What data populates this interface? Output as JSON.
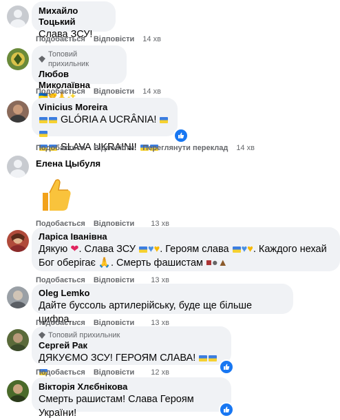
{
  "actions": {
    "like": "Подобається",
    "reply": "Відповісти",
    "translate": "Переглянути переклад"
  },
  "top_fan_label": "Топовий прихильник",
  "comments": [
    {
      "author": "Михайло Тоцький",
      "text": "Слава ЗСУ!",
      "time": "14 хв"
    },
    {
      "author": "Любов Миколаївна",
      "text": "🇺🇦🤝🙏✨",
      "time": "14 хв"
    },
    {
      "author": "Vinicius Moreira",
      "line1": "GLÓRIA A UCRÂNIA!",
      "line2": "SLAVA UKRAINI!",
      "time": "14 хв"
    },
    {
      "author": "Елена Цыбуля",
      "time": "13 хв"
    },
    {
      "author": "Ларіса Іванівна",
      "line1a": "Дякую",
      "line1b": ". Слава ЗСУ",
      "line1c": ". Героям слава",
      "line1d": ". Каждого нехай",
      "line2a": "Бог оберігає",
      "line2b": ". Смерть фашистам",
      "time": "13 хв"
    },
    {
      "author": "Oleg Lemko",
      "text": "Дайте буссоль артилерійську, буде ще більше цифра...",
      "time": "13 хв"
    },
    {
      "author": "Сергей Рак",
      "text": "ДЯКУЄМО ЗСУ!  ГЕРОЯМ СЛАВА!",
      "time": "12 хв"
    },
    {
      "author": "Вікторія Хлєбнікова",
      "text": "Смерть рашистам! Слава Героям України!"
    }
  ]
}
